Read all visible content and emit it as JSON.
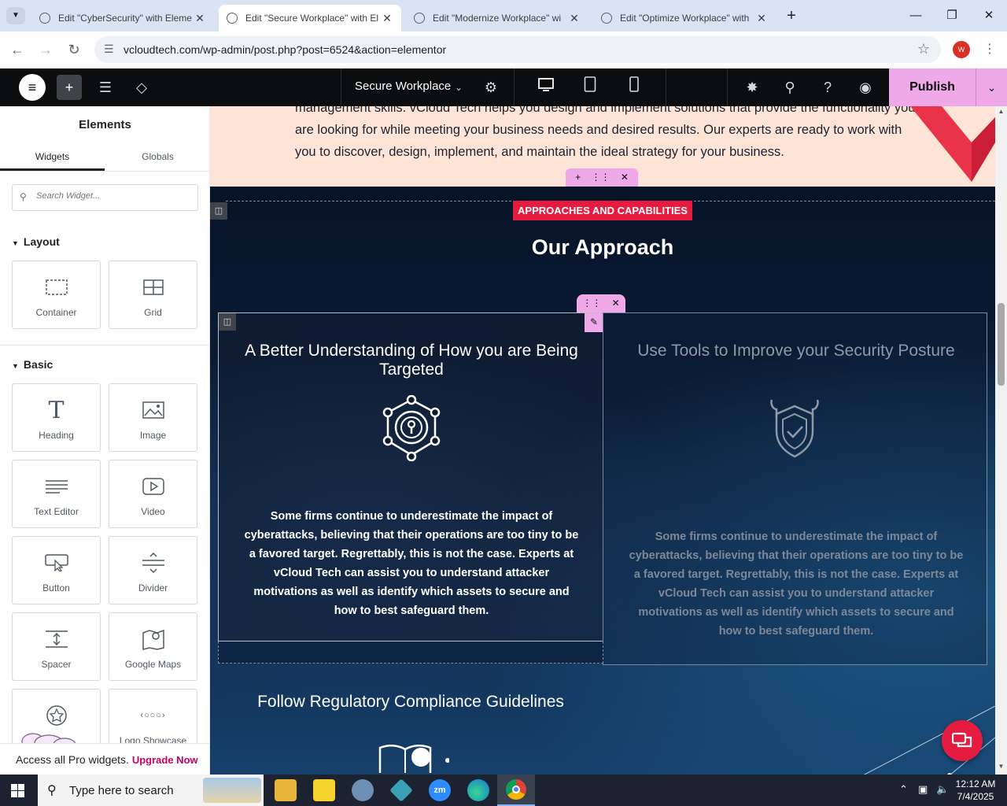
{
  "browser": {
    "tabs": [
      {
        "title": "Edit \"CyberSecurity\" with Eleme",
        "active": false
      },
      {
        "title": "Edit \"Secure Workplace\" with El",
        "active": true
      },
      {
        "title": "Edit \"Modernize Workplace\" wi",
        "active": false
      },
      {
        "title": "Edit \"Optimize Workplace\" with",
        "active": false
      }
    ],
    "url": "vcloudtech.com/wp-admin/post.php?post=6524&action=elementor",
    "profile_initial": "W"
  },
  "editor": {
    "document_title": "Secure Workplace",
    "publish_label": "Publish"
  },
  "panel": {
    "title": "Elements",
    "tabs": [
      "Widgets",
      "Globals"
    ],
    "search_placeholder": "Search Widget...",
    "categories": {
      "layout": {
        "label": "Layout",
        "widgets": [
          "Container",
          "Grid"
        ]
      },
      "basic": {
        "label": "Basic",
        "widgets": [
          "Heading",
          "Image",
          "Text Editor",
          "Video",
          "Button",
          "Divider",
          "Spacer",
          "Google Maps",
          "",
          "Logo Showcase"
        ]
      }
    },
    "pro_bar": {
      "text": "Access all Pro widgets.",
      "link": "Upgrade Now"
    }
  },
  "canvas": {
    "intro_text": "management skills. vCloud Tech helps you design and implement solutions that provide the functionality you are looking for while meeting your business needs and desired results. Our experts are ready to work with you to discover, design, implement, and maintain the ideal strategy for your business.",
    "eyebrow": "APPROACHES AND CAPABILITIES",
    "title": "Our Approach",
    "cards": [
      {
        "title": "A Better Understanding of How you are Being Targeted",
        "body": "Some firms continue to underestimate the impact of cyberattacks, believing that their operations are too tiny to be a favored target. Regrettably, this is not the case. Experts at vCloud Tech can assist you to understand attacker motivations as well as identify which assets to secure and how to best safeguard them.",
        "icon": "network-lock-icon"
      },
      {
        "title": "Use Tools to Improve your Security Posture",
        "body": "Some firms continue to underestimate the impact of cyberattacks, believing that their operations are too tiny to be a favored target. Regrettably, this is not the case. Experts at vCloud Tech can assist you to understand attacker motivations as well as identify which assets to secure and how to best safeguard them.",
        "icon": "shield-tools-icon"
      },
      {
        "title": "Follow Regulatory Compliance Guidelines",
        "icon": "book-search-icon"
      }
    ]
  },
  "taskbar": {
    "search_placeholder": "Type here to search",
    "time": "12:12 AM",
    "date": "7/4/2025"
  },
  "colors": {
    "accent_pink": "#f0a9e8",
    "badge_red": "#e51b3f",
    "upgrade_link": "#c40063"
  }
}
